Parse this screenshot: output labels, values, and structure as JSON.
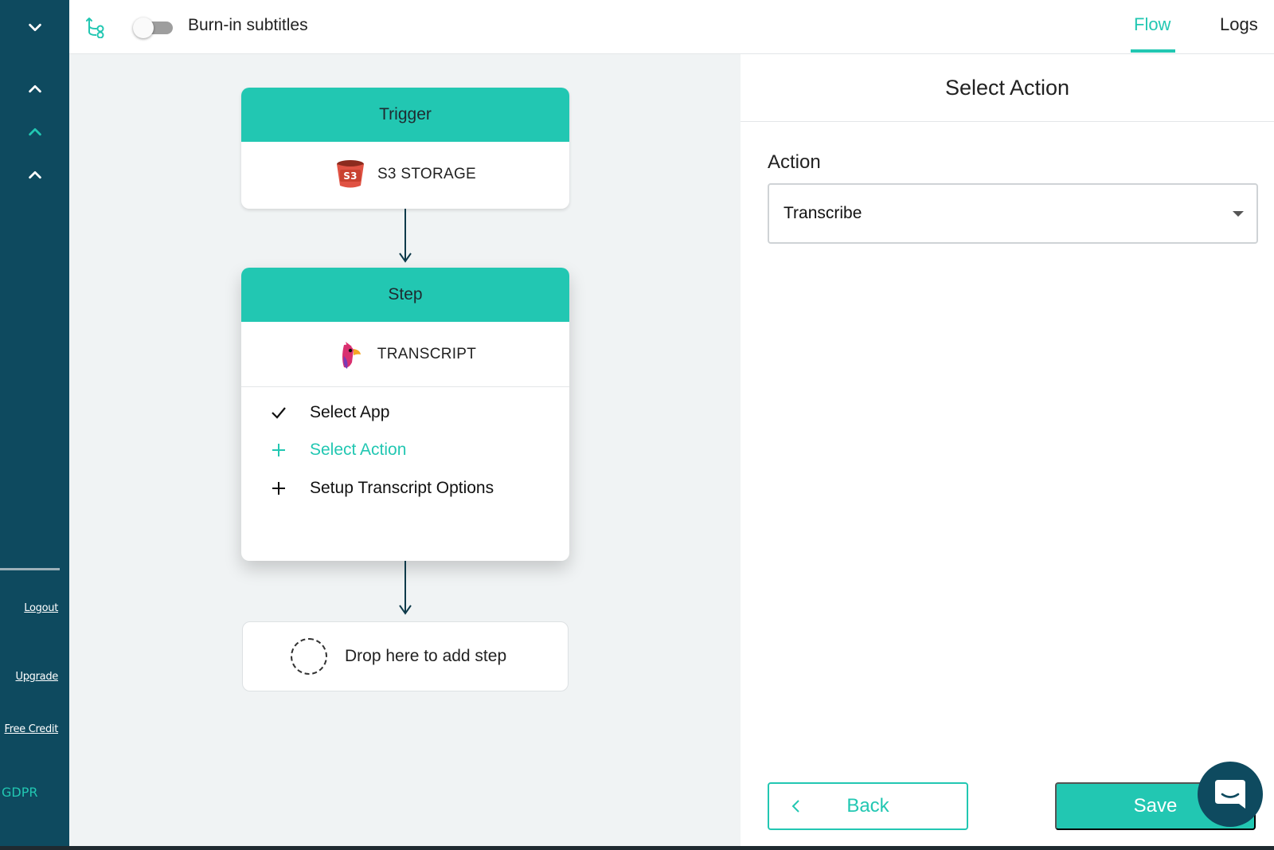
{
  "sidebar": {
    "links": {
      "logout": "Logout",
      "upgrade": "Upgrade",
      "free_credit": "Free Credit",
      "gdpr": "GDPR"
    }
  },
  "topbar": {
    "toggle_label": "Burn-in subtitles",
    "toggle_on": false,
    "tabs": [
      {
        "label": "Flow",
        "active": true
      },
      {
        "label": "Logs",
        "active": false
      }
    ]
  },
  "flow": {
    "trigger": {
      "title": "Trigger",
      "app": "S3 STORAGE",
      "app_icon": "s3-bucket-icon"
    },
    "step": {
      "title": "Step",
      "app": "TRANSCRIPT",
      "app_icon": "parrot-icon",
      "substeps": [
        {
          "label": "Select App",
          "status": "done"
        },
        {
          "label": "Select Action",
          "status": "active"
        },
        {
          "label": "Setup Transcript Options",
          "status": "pending"
        }
      ]
    },
    "drop_zone": "Drop here to add step"
  },
  "panel": {
    "title": "Select Action",
    "action_label": "Action",
    "action_value": "Transcribe",
    "back_label": "Back",
    "save_label": "Save"
  },
  "colors": {
    "accent": "#22c7b2",
    "sidebar": "#0e4a5f",
    "canvas": "#f0f3f4"
  }
}
